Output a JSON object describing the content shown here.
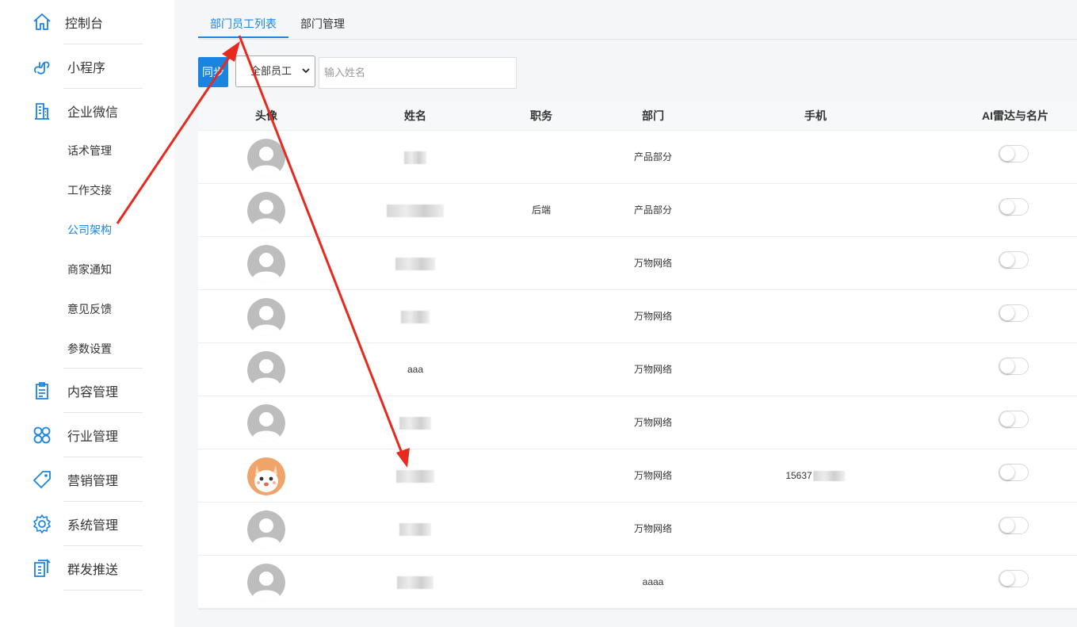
{
  "sidebar": {
    "main_top": [
      {
        "label": "控制台",
        "icon": "home-icon"
      },
      {
        "label": "小程序",
        "icon": "miniprogram-icon"
      },
      {
        "label": "企业微信",
        "icon": "building-icon"
      }
    ],
    "sub_items": [
      {
        "label": "话术管理"
      },
      {
        "label": "工作交接"
      },
      {
        "label": "公司架构",
        "active": true
      },
      {
        "label": "商家通知"
      },
      {
        "label": "意见反馈"
      },
      {
        "label": "参数设置"
      }
    ],
    "main_bottom": [
      {
        "label": "内容管理",
        "icon": "clipboard-icon"
      },
      {
        "label": "行业管理",
        "icon": "clover-icon"
      },
      {
        "label": "营销管理",
        "icon": "tag-icon"
      },
      {
        "label": "系统管理",
        "icon": "gear-icon"
      },
      {
        "label": "群发推送",
        "icon": "broadcast-icon"
      }
    ]
  },
  "tabs": [
    {
      "label": "部门员工列表",
      "active": true
    },
    {
      "label": "部门管理"
    }
  ],
  "toolbar": {
    "sync_label": "同步",
    "filter_value": "全部员工",
    "search_placeholder": "输入姓名"
  },
  "table": {
    "headers": [
      "头像",
      "姓名",
      "职务",
      "部门",
      "手机",
      "AI雷达与名片"
    ],
    "rows": [
      {
        "avatar": "default",
        "name": "",
        "position": "",
        "department": "产品部分",
        "phone": "",
        "ai_radar": false
      },
      {
        "avatar": "default",
        "name": "",
        "position": "后端",
        "department": "产品部分",
        "phone": "",
        "ai_radar": false
      },
      {
        "avatar": "default",
        "name": "",
        "position": "",
        "department": "万物网络",
        "phone": "",
        "ai_radar": false
      },
      {
        "avatar": "default",
        "name": "",
        "position": "",
        "department": "万物网络",
        "phone": "",
        "ai_radar": false
      },
      {
        "avatar": "default",
        "name": "aaa",
        "position": "",
        "department": "万物网络",
        "phone": "",
        "ai_radar": false
      },
      {
        "avatar": "default",
        "name": "",
        "position": "",
        "department": "万物网络",
        "phone": "",
        "ai_radar": false
      },
      {
        "avatar": "cartoon",
        "name": "",
        "position": "",
        "department": "万物网络",
        "phone": "15637",
        "ai_radar": false
      },
      {
        "avatar": "default",
        "name": "",
        "position": "",
        "department": "万物网络",
        "phone": "",
        "ai_radar": false
      },
      {
        "avatar": "default",
        "name": "",
        "position": "",
        "department": "aaaa",
        "phone": "",
        "ai_radar": false
      }
    ]
  },
  "colors": {
    "accent": "#1a84e0",
    "annotation": "#e8291f"
  }
}
